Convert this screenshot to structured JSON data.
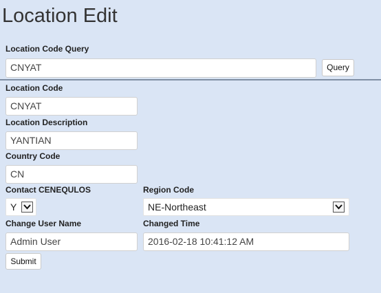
{
  "page": {
    "title": "Location Edit"
  },
  "query": {
    "label": "Location Code Query",
    "value": "CNYAT",
    "button_label": "Query"
  },
  "form": {
    "location_code": {
      "label": "Location Code",
      "value": "CNYAT"
    },
    "location_description": {
      "label": "Location Description",
      "value": "YANTIAN"
    },
    "country_code": {
      "label": "Country Code",
      "value": "CN"
    },
    "contact": {
      "label": "Contact CENEQULOS",
      "value": "Y"
    },
    "region_code": {
      "label": "Region Code",
      "value": "NE-Northeast"
    },
    "change_user_name": {
      "label": "Change User Name",
      "value": "Admin User"
    },
    "changed_time": {
      "label": "Changed Time",
      "value": "2016-02-18 10:41:12 AM"
    },
    "submit_label": "Submit"
  },
  "icons": {
    "dropdown": "chevron-down-icon"
  }
}
